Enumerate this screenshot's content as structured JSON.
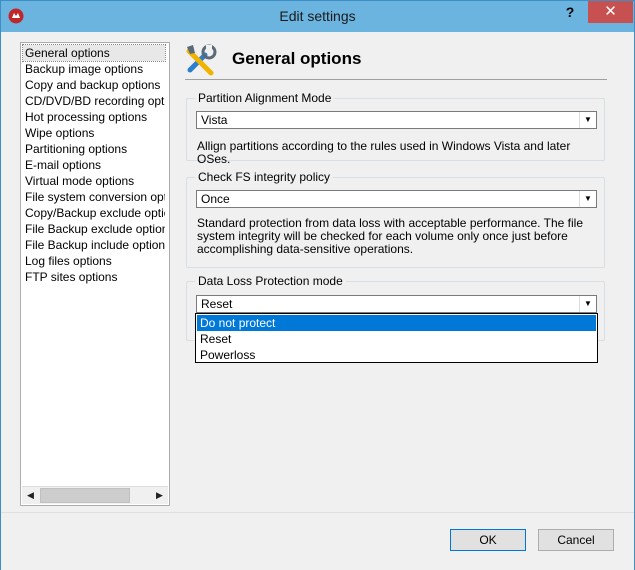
{
  "window": {
    "title": "Edit settings",
    "help_glyph": "?",
    "close_glyph": "✕"
  },
  "nav": {
    "items": [
      "General options",
      "Backup image options",
      "Copy and backup options",
      "CD/DVD/BD recording options",
      "Hot processing options",
      "Wipe options",
      "Partitioning options",
      "E-mail options",
      "Virtual mode options",
      "File system conversion options",
      "Copy/Backup exclude options",
      "File Backup exclude options",
      "File Backup include options",
      "Log files options",
      "FTP sites options"
    ],
    "selected_index": 0,
    "scroll_left_glyph": "◀",
    "scroll_right_glyph": "▶"
  },
  "header": {
    "title": "General options",
    "icon": "tools-icon"
  },
  "groups": {
    "alignment": {
      "label": "Partition Alignment Mode",
      "value": "Vista",
      "description": "Allign partitions according to the rules used in Windows Vista and later OSes."
    },
    "fs_integrity": {
      "label": "Check FS integrity policy",
      "value": "Once",
      "description": "Standard protection from data loss with acceptable performance. The file system integrity will be checked for each volume only once just before accomplishing data-sensitive operations."
    },
    "data_loss": {
      "label": "Data Loss Protection mode",
      "value": "Reset",
      "options": [
        "Do not protect",
        "Reset",
        "Powerloss"
      ],
      "highlighted_index": 0
    }
  },
  "select_arrow_glyph": "▼",
  "footer": {
    "ok_label": "OK",
    "cancel_label": "Cancel"
  },
  "colors": {
    "titlebar": "#6cb4e0",
    "close": "#c75050",
    "highlight": "#0078d7"
  }
}
